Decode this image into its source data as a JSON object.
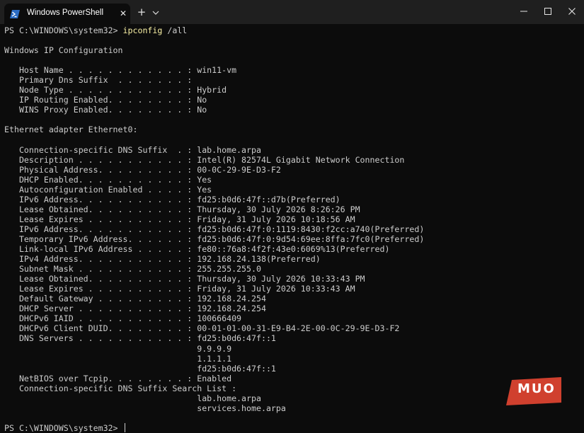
{
  "window": {
    "tab_title": "Windows PowerShell",
    "tab_icon": "powershell-icon",
    "close_tab_glyph": "✕",
    "new_tab_glyph": "+",
    "minimize_glyph": "—",
    "maximize_glyph": "☐",
    "close_glyph": "✕"
  },
  "terminal": {
    "prompt": "PS C:\\WINDOWS\\system32> ",
    "command": "ipconfig",
    "command_args": " /all",
    "output_lines": [
      "",
      "Windows IP Configuration",
      "",
      "   Host Name . . . . . . . . . . . . : win11-vm",
      "   Primary Dns Suffix  . . . . . . . :",
      "   Node Type . . . . . . . . . . . . : Hybrid",
      "   IP Routing Enabled. . . . . . . . : No",
      "   WINS Proxy Enabled. . . . . . . . : No",
      "",
      "Ethernet adapter Ethernet0:",
      "",
      "   Connection-specific DNS Suffix  . : lab.home.arpa",
      "   Description . . . . . . . . . . . : Intel(R) 82574L Gigabit Network Connection",
      "   Physical Address. . . . . . . . . : 00-0C-29-9E-D3-F2",
      "   DHCP Enabled. . . . . . . . . . . : Yes",
      "   Autoconfiguration Enabled . . . . : Yes",
      "   IPv6 Address. . . . . . . . . . . : fd25:b0d6:47f::d7b(Preferred)",
      "   Lease Obtained. . . . . . . . . . : Thursday, 30 July 2026 8:26:26 PM",
      "   Lease Expires . . . . . . . . . . : Friday, 31 July 2026 10:18:56 AM",
      "   IPv6 Address. . . . . . . . . . . : fd25:b0d6:47f:0:1119:8430:f2cc:a740(Preferred)",
      "   Temporary IPv6 Address. . . . . . : fd25:b0d6:47f:0:9d54:69ee:8ffa:7fc0(Preferred)",
      "   Link-local IPv6 Address . . . . . : fe80::76a8:4f2f:43e0:6069%13(Preferred)",
      "   IPv4 Address. . . . . . . . . . . : 192.168.24.138(Preferred)",
      "   Subnet Mask . . . . . . . . . . . : 255.255.255.0",
      "   Lease Obtained. . . . . . . . . . : Thursday, 30 July 2026 10:33:43 PM",
      "   Lease Expires . . . . . . . . . . : Friday, 31 July 2026 10:33:43 AM",
      "   Default Gateway . . . . . . . . . : 192.168.24.254",
      "   DHCP Server . . . . . . . . . . . : 192.168.24.254",
      "   DHCPv6 IAID . . . . . . . . . . . : 100666409",
      "   DHCPv6 Client DUID. . . . . . . . : 00-01-01-00-31-E9-B4-2E-00-0C-29-9E-D3-F2",
      "   DNS Servers . . . . . . . . . . . : fd25:b0d6:47f::1",
      "                                       9.9.9.9",
      "                                       1.1.1.1",
      "                                       fd25:b0d6:47f::1",
      "   NetBIOS over Tcpip. . . . . . . . : Enabled",
      "   Connection-specific DNS Suffix Search List :",
      "                                       lab.home.arpa",
      "                                       services.home.arpa",
      ""
    ],
    "final_prompt": "PS C:\\WINDOWS\\system32> "
  },
  "watermark": {
    "text": "MUO",
    "color": "#d0402e"
  },
  "colors": {
    "background": "#0c0c0c",
    "titlebar": "#1f1f1f",
    "text": "#cccccc",
    "command": "#f9f1a5"
  }
}
